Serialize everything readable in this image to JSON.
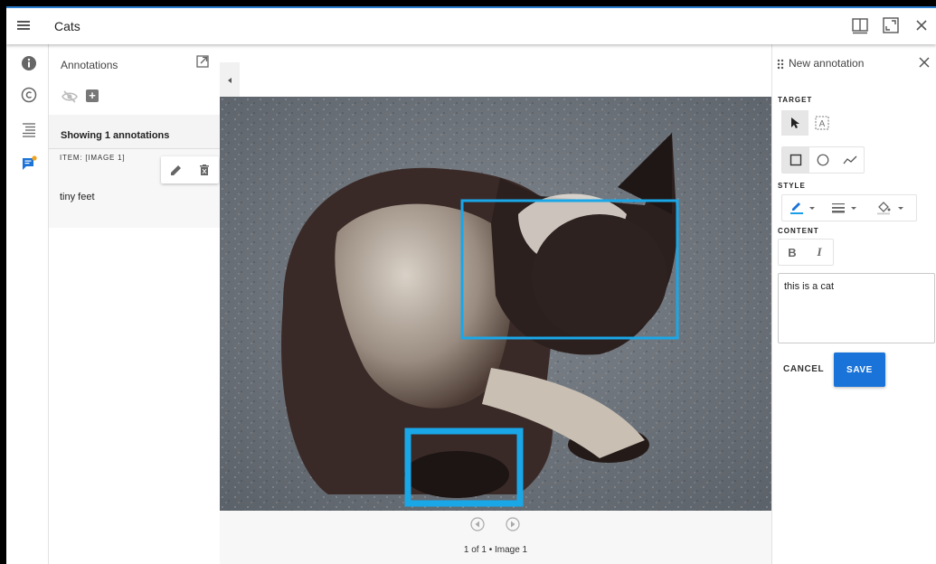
{
  "app": {
    "title": "Cats"
  },
  "annotations_panel": {
    "title": "Annotations",
    "showing_text": "Showing 1 annotations",
    "item": {
      "label": "ITEM: [IMAGE 1]",
      "text": "tiny feet"
    }
  },
  "viewer": {
    "pager_text": "1 of 1 • Image 1"
  },
  "new_annotation": {
    "title": "New annotation",
    "target_label": "TARGET",
    "style_label": "STYLE",
    "content_label": "CONTENT",
    "text_value": "this is a cat",
    "cancel_label": "CANCEL",
    "save_label": "SAVE"
  },
  "colors": {
    "accent": "#1a73d8",
    "annotation_box": "#1aa7e8",
    "notification_dot": "#f2a31b"
  },
  "icons": [
    "menu-icon",
    "split-view-icon",
    "fullscreen-icon",
    "close-icon",
    "info-icon",
    "copyright-icon",
    "toc-icon",
    "annotations-icon",
    "external-window-icon",
    "visibility-off-icon",
    "add-box-icon",
    "edit-icon",
    "delete-icon",
    "drag-handle-icon",
    "pointer-icon",
    "text-select-icon",
    "rectangle-icon",
    "ellipse-icon",
    "polyline-icon",
    "pen-color-icon",
    "line-weight-icon",
    "fill-color-icon",
    "bold-icon",
    "italic-icon",
    "prev-canvas-icon",
    "next-canvas-icon"
  ]
}
